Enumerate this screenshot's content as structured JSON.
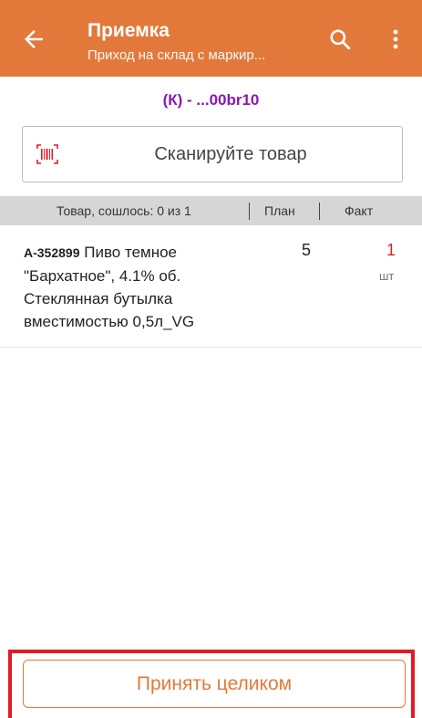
{
  "appbar": {
    "title": "Приемка",
    "subtitle": "Приход на склад с маркир...",
    "back_icon": "arrow-left-icon",
    "search_icon": "search-icon",
    "menu_icon": "more-vert-icon",
    "background": "#e2793a"
  },
  "document": {
    "code": "(К) - ...00br10"
  },
  "scan": {
    "icon": "barcode-icon",
    "label": "Сканируйте товар"
  },
  "table": {
    "headers": {
      "item": "Товар, сошлось: 0 из 1",
      "plan": "План",
      "fact": "Факт"
    },
    "rows": [
      {
        "article": "А-352899",
        "name": "Пиво темное \"Бархатное\", 4.1% об. Стеклянная бутылка вместимостью 0,5л_VG",
        "plan": "5",
        "fact": "1",
        "unit": "шт"
      }
    ]
  },
  "footer": {
    "accept_label": "Принять целиком",
    "highlight_color": "#e21b27"
  }
}
